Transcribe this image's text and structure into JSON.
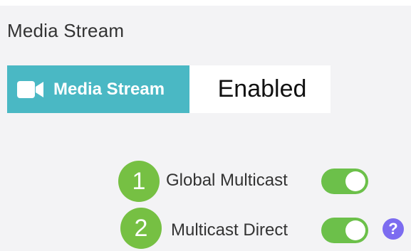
{
  "section": {
    "title": "Media Stream"
  },
  "tile": {
    "label": "Media Stream",
    "value": "Enabled",
    "icon": "video-camera-icon"
  },
  "options": [
    {
      "badge": "1",
      "label": "Global Multicast",
      "enabled": true
    },
    {
      "badge": "2",
      "label": "Multicast Direct",
      "enabled": true,
      "help": "?"
    }
  ],
  "colors": {
    "tile_accent": "#4ab8c4",
    "badge": "#76c043",
    "toggle_on": "#6cc04a",
    "help": "#7c6cf0"
  }
}
